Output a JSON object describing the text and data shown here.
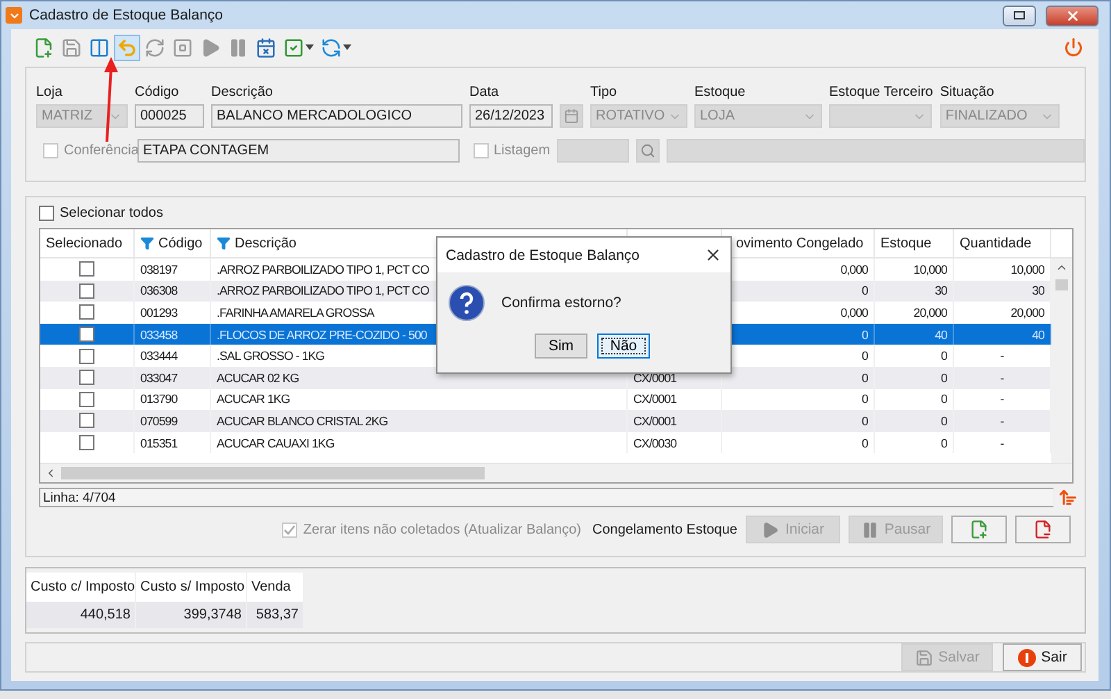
{
  "window": {
    "title": "Cadastro de Estoque Balanço"
  },
  "toolbar": [
    {
      "kind": "new",
      "disabled": false,
      "selected": false,
      "menu": false
    },
    {
      "kind": "save",
      "disabled": true,
      "selected": false,
      "menu": false
    },
    {
      "kind": "split",
      "disabled": false,
      "selected": false,
      "menu": false
    },
    {
      "kind": "undo",
      "disabled": false,
      "selected": true,
      "menu": false
    },
    {
      "kind": "refresh",
      "disabled": true,
      "selected": false,
      "menu": false
    },
    {
      "kind": "stop",
      "disabled": true,
      "selected": false,
      "menu": false
    },
    {
      "kind": "play",
      "disabled": true,
      "selected": false,
      "menu": false
    },
    {
      "kind": "pause",
      "disabled": true,
      "selected": false,
      "menu": false
    },
    {
      "kind": "sheet",
      "disabled": false,
      "selected": false,
      "menu": false
    },
    {
      "kind": "check",
      "disabled": false,
      "selected": false,
      "menu": true
    },
    {
      "kind": "sync",
      "disabled": false,
      "selected": false,
      "menu": true
    }
  ],
  "annotation": {
    "kind": "arrow"
  },
  "form": {
    "fields": [
      {
        "kind": "combo",
        "label": "Loja",
        "value": "MATRIZ",
        "disabled": true
      },
      {
        "kind": "text",
        "label": "Código",
        "value": "000025",
        "disabled": false
      },
      {
        "kind": "text",
        "label": "Descrição",
        "value": "BALANCO MERCADOLOGICO",
        "disabled": false
      },
      {
        "kind": "date",
        "label": "Data",
        "value": "26/12/2023",
        "disabled": false
      },
      {
        "kind": "combo",
        "label": "Tipo",
        "value": "ROTATIVO",
        "disabled": true
      },
      {
        "kind": "combo",
        "label": "Estoque",
        "value": "LOJA",
        "disabled": true
      },
      {
        "kind": "combo",
        "label": "Estoque Terceiro",
        "disabled": true
      },
      {
        "kind": "combo",
        "label": "Situação",
        "value": "FINALIZADO",
        "disabled": true
      }
    ],
    "conferencia": {
      "label": "Conferência",
      "checked": false,
      "disabled": true,
      "value": "ETAPA CONTAGEM"
    },
    "listagem": {
      "label": "Listagem",
      "checked": false,
      "disabled": true
    }
  },
  "select_all": {
    "label": "Selecionar todos",
    "checked": false
  },
  "table": {
    "columns": [
      {
        "label": "Selecionado",
        "filter": false
      },
      {
        "label": "Código",
        "filter": true
      },
      {
        "label": "Descrição",
        "filter": true
      },
      {
        "label": "ovimento Congelado",
        "filter": false
      },
      {
        "label": "Estoque",
        "filter": false
      },
      {
        "label": "Quantidade",
        "filter": false
      }
    ],
    "rows": [
      {
        "checked": false,
        "selected": false,
        "code": "038197",
        "description": ".ARROZ PARBOILIZADO TIPO 1, PCT CO",
        "frozen": "0,000",
        "stock": "10,000",
        "quantity": "10,000"
      },
      {
        "checked": false,
        "selected": false,
        "code": "036308",
        "description": ".ARROZ PARBOILIZADO TIPO 1, PCT CO",
        "frozen": "0",
        "stock": "30",
        "quantity": "30"
      },
      {
        "checked": false,
        "selected": false,
        "code": "001293",
        "description": ".FARINHA AMARELA GROSSA",
        "frozen": "0,000",
        "stock": "20,000",
        "quantity": "20,000"
      },
      {
        "checked": false,
        "selected": true,
        "code": "033458",
        "description": ".FLOCOS DE ARROZ PRE-COZIDO - 500",
        "frozen": "0",
        "stock": "40",
        "quantity": "40"
      },
      {
        "checked": false,
        "selected": false,
        "code": "033444",
        "description": ".SAL GROSSO - 1KG",
        "frozen": "0",
        "stock": "0",
        "quantity": "-"
      },
      {
        "checked": false,
        "selected": false,
        "code": "033047",
        "description": "ACUCAR 02 KG",
        "unit": "CX/0001",
        "frozen": "0",
        "stock": "0",
        "quantity": "-"
      },
      {
        "checked": false,
        "selected": false,
        "code": "013790",
        "description": "ACUCAR 1KG",
        "unit": "CX/0001",
        "frozen": "0",
        "stock": "0",
        "quantity": "-"
      },
      {
        "checked": false,
        "selected": false,
        "code": "070599",
        "description": "ACUCAR BLANCO CRISTAL 2KG",
        "unit": "CX/0001",
        "frozen": "0",
        "stock": "0",
        "quantity": "-"
      },
      {
        "checked": false,
        "selected": false,
        "code": "015351",
        "description": "ACUCAR CAUAXI 1KG",
        "unit": "CX/0030",
        "frozen": "0",
        "stock": "0",
        "quantity": "-"
      }
    ]
  },
  "row_counter": "Linha: 4/704",
  "options": {
    "reset": {
      "label": "Zerar itens não coletados (Atualizar Balanço)",
      "checked": true,
      "disabled": true
    },
    "freeze_label": "Congelamento Estoque",
    "buttons": [
      {
        "kind": "start",
        "label": "Iniciar",
        "disabled": true
      },
      {
        "kind": "pause",
        "label": "Pausar",
        "disabled": true
      },
      {
        "kind": "add",
        "disabled": false
      },
      {
        "kind": "remove",
        "disabled": false
      }
    ]
  },
  "summary": {
    "columns": [
      "Custo c/ Imposto",
      "Custo s/ Imposto",
      "Venda"
    ],
    "values": [
      "440,518",
      "399,3748",
      "583,37"
    ]
  },
  "footer": [
    {
      "kind": "save",
      "label": "Salvar",
      "disabled": true
    },
    {
      "kind": "exit",
      "label": "Sair",
      "disabled": false
    }
  ],
  "dialog": {
    "title": "Cadastro de Estoque Balanço",
    "message": "Confirma estorno?",
    "buttons": [
      {
        "label": "Sim",
        "selected": false
      },
      {
        "label": "Não",
        "selected": true
      }
    ]
  }
}
